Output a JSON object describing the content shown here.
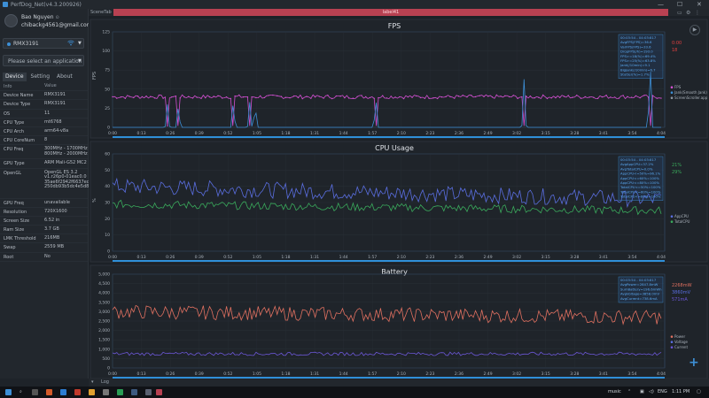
{
  "window": {
    "title": "PerfDog_Net(v4.3.200926)",
    "btn_min": "—",
    "btn_max": "☐",
    "btn_close": "✕"
  },
  "account": {
    "name": "Bao Nguyen",
    "email": "chibackg4561@gmail.com"
  },
  "device_selector": {
    "name": "RMX3191",
    "caret": "▼"
  },
  "app_selector": {
    "placeholder": "Please select an application",
    "caret": "▼"
  },
  "tabs": [
    {
      "label": "Device",
      "active": true
    },
    {
      "label": "Setting",
      "active": false
    },
    {
      "label": "About",
      "active": false
    }
  ],
  "info_header": {
    "key": "Info",
    "value": "Value"
  },
  "info_rows": [
    {
      "key": "Device Name",
      "value": "RMX3191"
    },
    {
      "key": "Device Type",
      "value": "RMX3191"
    },
    {
      "key": "OS",
      "value": "11"
    },
    {
      "key": "CPU Type",
      "value": "mt6768"
    },
    {
      "key": "CPU Arch",
      "value": "arm64-v8a"
    },
    {
      "key": "CPU CoreNum",
      "value": "8"
    },
    {
      "key": "CPU Freq",
      "value": "300MHz - 1700MHz\n800MHz - 2000MHz"
    },
    {
      "key": "GPU Type",
      "value": "ARM Mali-G52 MC2"
    },
    {
      "key": "OpenGL",
      "value": "OpenGL ES 3.2\nv1.r26p0-01eac0.0\n35ae6f2942f6637ec3\n250db93b5dc4e5d84"
    },
    {
      "key": "GPU Freq",
      "value": "unavailable"
    },
    {
      "key": "Resolution",
      "value": "720X1600"
    },
    {
      "key": "Screen Size",
      "value": "6.52 in"
    },
    {
      "key": "Ram Size",
      "value": "3.7 GB"
    },
    {
      "key": "LMK Threshold",
      "value": "216MB"
    },
    {
      "key": "Swap",
      "value": "2559 MB"
    },
    {
      "key": "Root",
      "value": "No"
    }
  ],
  "top_tabs": {
    "scene": "SceneTab",
    "label": "label41"
  },
  "log_label": "Log",
  "taskbar": {
    "lang": "ENG",
    "time": "1:11 PM",
    "music": "music",
    "caret": "⌃"
  },
  "colors": {
    "accent": "#3d8fd6",
    "fps": "#d24fd1",
    "cpu_total": "#3aaa5c",
    "power": "#e07060",
    "red_tab": "#b84152"
  },
  "x_ticks": [
    "0:00",
    "0:13",
    "0:26",
    "0:39",
    "0:52",
    "1:05",
    "1:18",
    "1:31",
    "1:44",
    "1:57",
    "2:10",
    "2:23",
    "2:36",
    "2:49",
    "3:02",
    "3:15",
    "3:28",
    "3:41",
    "3:54",
    "4:04"
  ],
  "chart_data": [
    {
      "type": "line",
      "title": "FPS",
      "ylabel": "FPS",
      "ylim": [
        0,
        125
      ],
      "yticks": [
        0,
        25,
        50,
        75,
        100,
        125
      ],
      "legend": [
        "FPS",
        "Jank(Smooth Jank)",
        "ScreenScroller.app"
      ],
      "readout": [
        "0:00",
        "18"
      ],
      "tooltip": [
        "00:03:54 - 04:03:817",
        "AvgFPS(FPS)=36.6",
        "VarFPS(FPS)=33.6",
        "DropFPS(/h)=193.0",
        "FPS>=18(%)=69.4%",
        "FPS>=25(%)=63.8%",
        "Jank(/10min)=9.1",
        "BigJank(/10min)=6.7",
        "Stutter(%)=1.7%"
      ],
      "series": [
        {
          "name": "FPS",
          "color": "#d24fd1",
          "base": 40,
          "noise": 2.5
        },
        {
          "name": "Jank",
          "color": "#3d8fd6",
          "spikes": [
            [
              0.1,
              30
            ],
            [
              0.12,
              30
            ],
            [
              0.22,
              35
            ],
            [
              0.25,
              33
            ],
            [
              0.26,
              30
            ],
            [
              0.48,
              40
            ],
            [
              0.75,
              63
            ],
            [
              0.98,
              90
            ]
          ]
        }
      ]
    },
    {
      "type": "line",
      "title": "CPU Usage",
      "ylabel": "%",
      "ylim": [
        0,
        60
      ],
      "yticks": [
        0,
        10,
        20,
        30,
        40,
        50,
        60
      ],
      "legend": [
        "AppCPU",
        "TotalCPU"
      ],
      "readout": [
        "21%",
        "29%"
      ],
      "tooltip": [
        "00:03:54 - 04:03:817",
        "AvgAppCPU=37.2%",
        "AvgTotalCPU=0.0%",
        "AppCPU<=50%=96.1%",
        "AppCPU<=60%=100%",
        "AppCPU<=80%=100%",
        "TotalCPU<=50%=100%",
        "TotalCPU<=60%=100%",
        "TotalCPU<=80%=100%"
      ],
      "series": [
        {
          "name": "AppCPU",
          "color": "#5a6ee0",
          "base": 40,
          "trend": -8,
          "noise": 5
        },
        {
          "name": "TotalCPU",
          "color": "#3aaa5c",
          "base": 29,
          "trend": -4,
          "noise": 2.5
        }
      ]
    },
    {
      "type": "line",
      "title": "Battery",
      "ylabel": "",
      "ylim": [
        0,
        5000
      ],
      "yticks": [
        0,
        500,
        1000,
        1500,
        2000,
        2500,
        3000,
        3500,
        4000,
        4500,
        5000
      ],
      "legend": [
        "Power",
        "Voltage",
        "Current"
      ],
      "readout": [
        "2268mW",
        "3860mV",
        "571mA"
      ],
      "tooltip": [
        "00:03:54 - 04:03:817",
        "AvgPower=2847.8mW",
        "SumBattery=196.6mWh",
        "AvgVoltage=3858.0mV",
        "AvgCurrent=738.6mA"
      ],
      "series": [
        {
          "name": "Power",
          "color": "#e07060",
          "base": 3000,
          "trend": -300,
          "noise": 380
        },
        {
          "name": "Voltage",
          "color": "#6b57d6",
          "base": 750,
          "trend": 0,
          "noise": 90
        }
      ]
    }
  ]
}
